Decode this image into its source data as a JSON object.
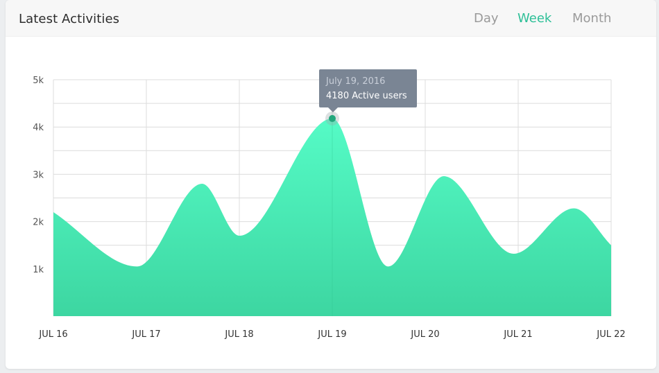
{
  "header": {
    "title": "Latest Activities",
    "tabs": [
      {
        "label": "Day",
        "active": false
      },
      {
        "label": "Week",
        "active": true
      },
      {
        "label": "Month",
        "active": false
      }
    ]
  },
  "tooltip": {
    "date": "July 19, 2016",
    "value_text": "4180 Active users"
  },
  "colors": {
    "accent": "#2dbf97",
    "area_top": "#55fbc6",
    "area_bottom": "#3dd6a1",
    "tooltip_bg": "#7a8594",
    "grid": "#dcdcdc"
  },
  "chart_data": {
    "type": "area",
    "ylim": [
      0,
      5000
    ],
    "yticks": [
      1000,
      2000,
      3000,
      4000,
      5000
    ],
    "ytick_labels": [
      "1k",
      "2k",
      "3k",
      "4k",
      "5k"
    ],
    "categories": [
      "JUL 16",
      "JUL 17",
      "JUL 18",
      "JUL 19",
      "JUL 20",
      "JUL 21",
      "JUL 22"
    ],
    "series": [
      {
        "x": [
          0,
          0.9,
          1.6,
          2.0,
          3.0,
          3.6,
          4.2,
          4.95,
          5.6,
          6.0
        ],
        "values": [
          2200,
          1050,
          2800,
          1700,
          4180,
          1050,
          2960,
          1320,
          2280,
          1500
        ]
      }
    ],
    "highlight": {
      "x": 3.0,
      "value": 4180
    },
    "grid": true
  }
}
